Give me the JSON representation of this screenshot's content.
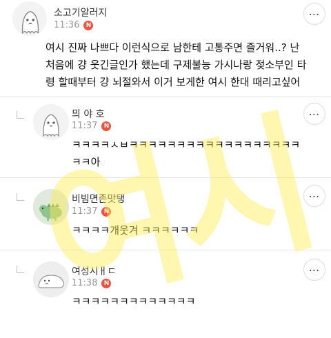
{
  "comments": [
    {
      "username": "소고기알러지",
      "time": "11:36",
      "badge": "N",
      "lines": [
        "여시 진짜 나쁘다 이런식으로 남한테 고통주면 즐거워..? 난",
        "처음에 걍 웃긴글인가 했는데 구제불능 가시나랑 젖소부인 타",
        "령 할때부터 걍 뇌절와서 이거 보게한 여시 한대 때리고싶어"
      ],
      "avatar_icon": "ghost-avatar-icon"
    },
    {
      "username": "믜 야 호",
      "time": "11:37",
      "badge": "N",
      "lines": [
        "ㅋㅋㅋㅋㅅㅂㅋㅋㅋㅋㅋㅋㅋㅋㅋㅋㅋㅋㅋㅋㅋㅋㅋㅋ",
        "ㅋㅋ아"
      ],
      "avatar_icon": "ghost-avatar-icon"
    },
    {
      "username": "비빔면존맛탱",
      "time": "11:37",
      "badge": "N",
      "lines": [
        "ㅋㅋㅋㅋ개웃겨 ㅋㅋㅋㅋㅋㅋ"
      ],
      "avatar_icon": "dinosaur-avatar-icon"
    },
    {
      "username": "여성시ㅐㄷ",
      "time": "11:38",
      "badge": "N",
      "lines": [
        "ㅋㅋㅋㅋㅋㅋㅋㅋㅋㅋㅋㅋㅋ"
      ],
      "avatar_icon": "seal-avatar-icon"
    }
  ],
  "watermark": "여시",
  "more_icon": "more-dots-icon",
  "reply_icon": "reply-corner-icon",
  "colors": {
    "badge": "#f0533a",
    "watermark": "#ffec50"
  }
}
